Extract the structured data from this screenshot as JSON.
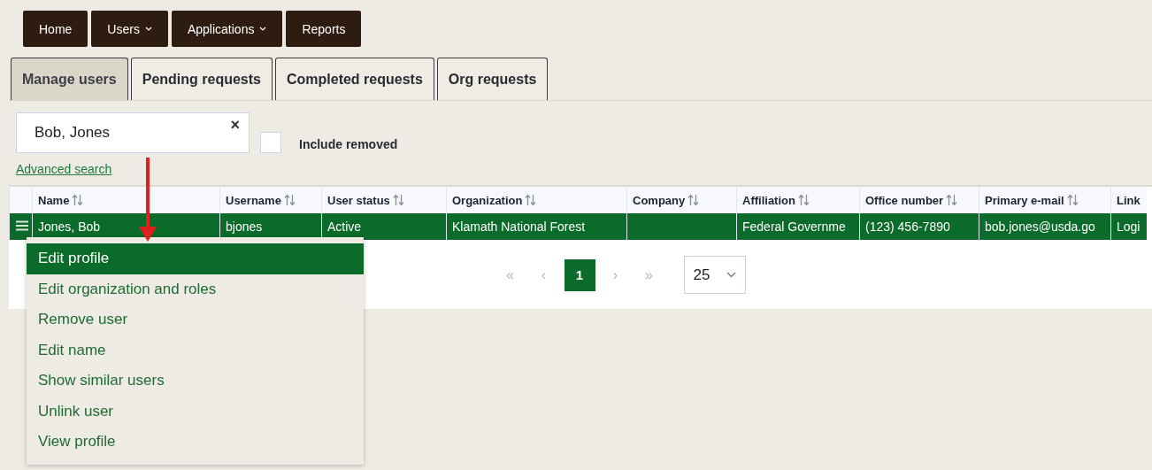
{
  "nav": [
    {
      "label": "Home",
      "dropdown": false
    },
    {
      "label": "Users",
      "dropdown": true
    },
    {
      "label": "Applications",
      "dropdown": true
    },
    {
      "label": "Reports",
      "dropdown": false
    }
  ],
  "tabs": [
    {
      "label": "Manage users",
      "selected": true
    },
    {
      "label": "Pending requests",
      "selected": false
    },
    {
      "label": "Completed requests",
      "selected": false
    },
    {
      "label": "Org requests",
      "selected": false
    }
  ],
  "search": {
    "value": "Bob, Jones",
    "clear": "×"
  },
  "include_removed": {
    "label": "Include removed",
    "checked": false
  },
  "advanced_search": "Advanced search",
  "table": {
    "columns": [
      "Name",
      "Username",
      "User status",
      "Organization",
      "Company",
      "Affiliation",
      "Office number",
      "Primary e-mail",
      "Link"
    ],
    "rows": [
      {
        "selected": true,
        "cells": [
          "Jones, Bob",
          "bjones",
          "Active",
          "Klamath National Forest",
          "",
          "Federal Governme",
          "(123) 456-7890",
          "bob.jones@usda.go",
          "Logi"
        ]
      }
    ]
  },
  "pagination": {
    "first": "«",
    "prev": "‹",
    "pages": [
      {
        "label": "1",
        "selected": true
      }
    ],
    "next": "›",
    "last": "»",
    "page_size": "25"
  },
  "row_menu": [
    {
      "label": "Edit profile",
      "selected": true
    },
    {
      "label": "Edit organization and roles",
      "selected": false
    },
    {
      "label": "Remove user",
      "selected": false
    },
    {
      "label": "Edit name",
      "selected": false
    },
    {
      "label": "Show similar users",
      "selected": false
    },
    {
      "label": "Unlink user",
      "selected": false
    },
    {
      "label": "View profile",
      "selected": false
    }
  ]
}
